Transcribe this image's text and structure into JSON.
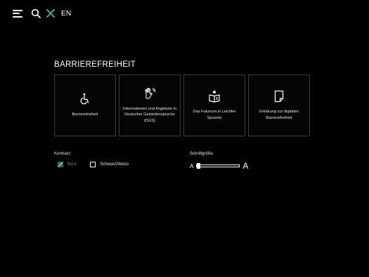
{
  "topbar": {
    "language": "EN"
  },
  "page": {
    "heading": "BARRIEREFREIHEIT"
  },
  "cards": [
    {
      "icon": "wheelchair-icon",
      "label": "Barrierefreiheit"
    },
    {
      "icon": "sign-language-icon",
      "label": "Informationen und Angebote in Deutscher Gebärdensprache (DGS)"
    },
    {
      "icon": "easy-language-icon",
      "label": "Das Futurium in Leichter Sprache"
    },
    {
      "icon": "document-icon",
      "label": "Erklärung zur digitalen Barrierefreiheit"
    }
  ],
  "contrast": {
    "label": "Kontrast:",
    "options": [
      {
        "label": "Bunt",
        "selected": true
      },
      {
        "label": "Schwarz/Weiss",
        "selected": false
      }
    ]
  },
  "font_size": {
    "label": "Schriftgröße:",
    "small_glyph": "A",
    "large_glyph": "A",
    "level": 0
  },
  "colors": {
    "accent": "#3aa184",
    "background": "#000000",
    "card_border": "#3d3d3d"
  }
}
